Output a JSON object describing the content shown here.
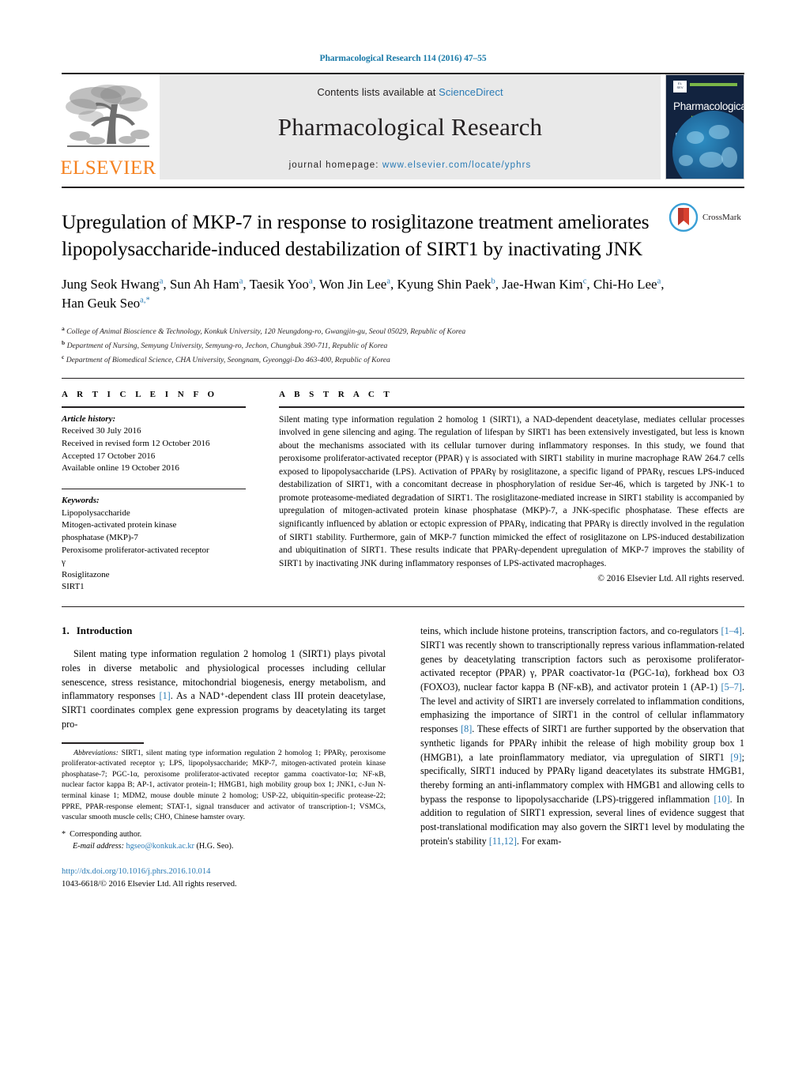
{
  "running_head": "Pharmacological Research 114 (2016) 47–55",
  "masthead": {
    "publisher_name": "ELSEVIER",
    "contents_prefix": "Contents lists available at ",
    "contents_link": "ScienceDirect",
    "journal_title": "Pharmacological Research",
    "homepage_prefix": "journal homepage: ",
    "homepage_url": "www.elsevier.com/locate/yphrs",
    "cover": {
      "line1": "Pharmacological",
      "line2": "research",
      "accent_color": "#8cc63f",
      "bg_color": "#12233f"
    }
  },
  "article": {
    "title": "Upregulation of MKP-7 in response to rosiglitazone treatment ameliorates lipopolysaccharide-induced destabilization of SIRT1 by inactivating JNK",
    "crossmark_label": "CrossMark",
    "authors_line1": "Jung Seok Hwang",
    "authors": [
      {
        "name": "Jung Seok Hwang",
        "mark": "a"
      },
      {
        "name": "Sun Ah Ham",
        "mark": "a"
      },
      {
        "name": "Taesik Yoo",
        "mark": "a"
      },
      {
        "name": "Won Jin Lee",
        "mark": "a"
      },
      {
        "name": "Kyung Shin Paek",
        "mark": "b"
      },
      {
        "name": "Jae-Hwan Kim",
        "mark": "c"
      },
      {
        "name": "Chi-Ho Lee",
        "mark": "a"
      },
      {
        "name": "Han Geuk Seo",
        "mark": "a,*"
      }
    ],
    "affiliations": [
      {
        "mark": "a",
        "text": "College of Animal Bioscience & Technology, Konkuk University, 120 Neungdong-ro, Gwangjin-gu, Seoul 05029, Republic of Korea"
      },
      {
        "mark": "b",
        "text": "Department of Nursing, Semyung University, Semyung-ro, Jechon, Chungbuk 390-711, Republic of Korea"
      },
      {
        "mark": "c",
        "text": "Department of Biomedical Science, CHA University, Seongnam, Gyeonggi-Do 463-400, Republic of Korea"
      }
    ]
  },
  "article_info": {
    "heading": "A R T I C L E   I N F O",
    "history_label": "Article history:",
    "history": [
      "Received 30 July 2016",
      "Received in revised form 12 October 2016",
      "Accepted 17 October 2016",
      "Available online 19 October 2016"
    ],
    "keywords_label": "Keywords:",
    "keywords": [
      "Lipopolysaccharide",
      "Mitogen-activated protein kinase",
      "phosphatase (MKP)-7",
      "Peroxisome proliferator-activated receptor",
      "γ",
      "Rosiglitazone",
      "SIRT1"
    ]
  },
  "abstract": {
    "heading": "A B S T R A C T",
    "text": "Silent mating type information regulation 2 homolog 1 (SIRT1), a NAD-dependent deacetylase, mediates cellular processes involved in gene silencing and aging. The regulation of lifespan by SIRT1 has been extensively investigated, but less is known about the mechanisms associated with its cellular turnover during inflammatory responses. In this study, we found that peroxisome proliferator-activated receptor (PPAR) γ is associated with SIRT1 stability in murine macrophage RAW 264.7 cells exposed to lipopolysaccharide (LPS). Activation of PPARγ by rosiglitazone, a specific ligand of PPARγ, rescues LPS-induced destabilization of SIRT1, with a concomitant decrease in phosphorylation of residue Ser-46, which is targeted by JNK-1 to promote proteasome-mediated degradation of SIRT1. The rosiglitazone-mediated increase in SIRT1 stability is accompanied by upregulation of mitogen-activated protein kinase phosphatase (MKP)-7, a JNK-specific phosphatase. These effects are significantly influenced by ablation or ectopic expression of PPARγ, indicating that PPARγ is directly involved in the regulation of SIRT1 stability. Furthermore, gain of MKP-7 function mimicked the effect of rosiglitazone on LPS-induced destabilization and ubiquitination of SIRT1. These results indicate that PPARγ-dependent upregulation of MKP-7 improves the stability of SIRT1 by inactivating JNK during inflammatory responses of LPS-activated macrophages.",
    "copyright": "© 2016 Elsevier Ltd. All rights reserved."
  },
  "introduction": {
    "number": "1.",
    "heading": "Introduction",
    "left_paragraph_a": "Silent mating type information regulation 2 homolog 1 (SIRT1) plays pivotal roles in diverse metabolic and physiological processes including cellular senescence, stress resistance, mitochondrial biogenesis, energy metabolism, and inflammatory responses ",
    "left_ref_a": "[1]",
    "left_paragraph_b": ". As a NAD⁺-dependent class III protein deacetylase, SIRT1 coordinates complex gene expression programs by deacetylating its target pro-",
    "right_segments": [
      {
        "t": "teins, which include histone proteins, transcription factors, and co-regulators "
      },
      {
        "r": "[1–4]"
      },
      {
        "t": ". SIRT1 was recently shown to transcriptionally repress various inflammation-related genes by deacetylating transcription factors such as peroxisome proliferator-activated receptor (PPAR) γ, PPAR coactivator-1α (PGC-1α), forkhead box O3 (FOXO3), nuclear factor kappa B (NF-κB), and activator protein 1 (AP-1) "
      },
      {
        "r": "[5–7]"
      },
      {
        "t": ". The level and activity of SIRT1 are inversely correlated to inflammation conditions, emphasizing the importance of SIRT1 in the control of cellular inflammatory responses "
      },
      {
        "r": "[8]"
      },
      {
        "t": ". These effects of SIRT1 are further supported by the observation that synthetic ligands for PPARγ inhibit the release of high mobility group box 1 (HMGB1), a late proinflammatory mediator, via upregulation of SIRT1 "
      },
      {
        "r": "[9]"
      },
      {
        "t": "; specifically, SIRT1 induced by PPARγ ligand deacetylates its substrate HMGB1, thereby forming an anti-inflammatory complex with HMGB1 and allowing cells to bypass the response to lipopolysaccharide (LPS)-triggered inflammation "
      },
      {
        "r": "[10]"
      },
      {
        "t": ". In addition to regulation of SIRT1 expression, several lines of evidence suggest that post-translational modification may also govern the SIRT1 level by modulating the protein's stability "
      },
      {
        "r": "[11,12]"
      },
      {
        "t": ". For exam-"
      }
    ]
  },
  "footnotes": {
    "abbrev_label": "Abbreviations:",
    "abbrev_text": " SIRT1, silent mating type information regulation 2 homolog 1; PPARγ, peroxisome proliferator-activated receptor γ; LPS, lipopolysaccharide; MKP-7, mitogen-activated protein kinase phosphatase-7; PGC-1α, peroxisome proliferator-activated receptor gamma coactivator-1α; NF-κB, nuclear factor kappa B; AP-1, activator protein-1; HMGB1, high mobility group box 1; JNK1, c-Jun N-terminal kinase 1; MDM2, mouse double minute 2 homolog; USP-22, ubiquitin-specific protease-22; PPRE, PPAR-response element; STAT-1, signal transducer and activator of transcription-1; VSMCs, vascular smooth muscle cells; CHO, Chinese hamster ovary.",
    "corresponding_star": "*",
    "corresponding_label": "Corresponding author.",
    "email_label": "E-mail address:",
    "email": "hgseo@konkuk.ac.kr",
    "email_suffix": " (H.G. Seo).",
    "doi": "http://dx.doi.org/10.1016/j.phrs.2016.10.014",
    "issn_line": "1043-6618/© 2016 Elsevier Ltd. All rights reserved."
  }
}
